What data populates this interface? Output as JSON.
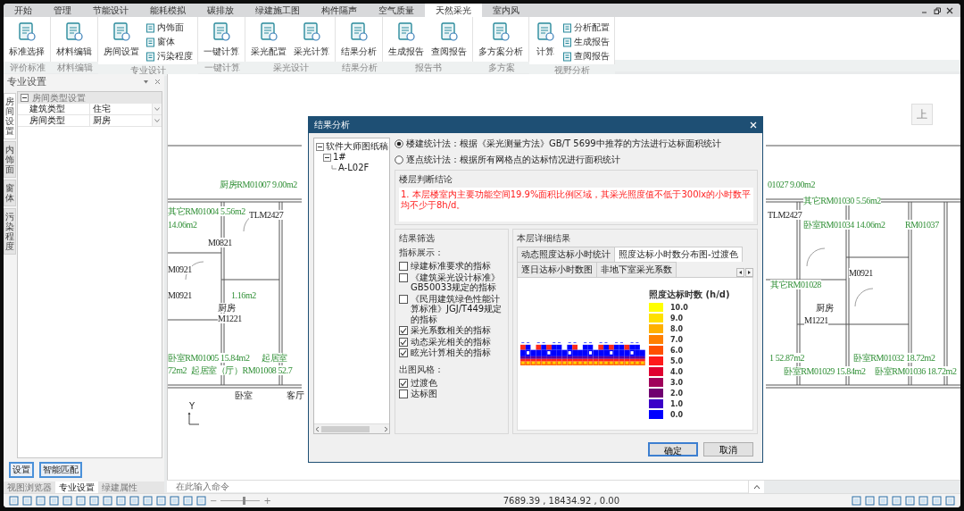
{
  "menu_tabs": [
    {
      "label": "开始",
      "selected": false
    },
    {
      "label": "管理",
      "selected": false
    },
    {
      "label": "节能设计",
      "selected": false
    },
    {
      "label": "能耗模拟",
      "selected": false
    },
    {
      "label": "碳排放",
      "selected": false
    },
    {
      "label": "绿建施工图",
      "selected": false
    },
    {
      "label": "构件隔声",
      "selected": false
    },
    {
      "label": "空气质量",
      "selected": false
    },
    {
      "label": "天然采光",
      "selected": true
    },
    {
      "label": "室内风",
      "selected": false
    }
  ],
  "ribbon": {
    "groups": [
      {
        "label": "评价标准",
        "buttons": [
          {
            "label": "标准选择",
            "kind": "large"
          }
        ]
      },
      {
        "label": "材料编辑",
        "buttons": [
          {
            "label": "材料编辑",
            "kind": "large"
          }
        ]
      },
      {
        "label": "专业设计",
        "buttons": [
          {
            "label": "房间设置",
            "kind": "large"
          },
          {
            "label": "内饰面",
            "kind": "small"
          },
          {
            "label": "窗体",
            "kind": "small"
          },
          {
            "label": "污染程度",
            "kind": "small"
          }
        ]
      },
      {
        "label": "一键计算",
        "buttons": [
          {
            "label": "一键计算",
            "kind": "large"
          }
        ]
      },
      {
        "label": "采光设计",
        "buttons": [
          {
            "label": "采光配置",
            "kind": "large"
          },
          {
            "label": "采光计算",
            "kind": "large"
          }
        ]
      },
      {
        "label": "结果分析",
        "buttons": [
          {
            "label": "结果分析",
            "kind": "large"
          }
        ]
      },
      {
        "label": "报告书",
        "buttons": [
          {
            "label": "生成报告",
            "kind": "large"
          },
          {
            "label": "查阅报告",
            "kind": "large"
          }
        ]
      },
      {
        "label": "多方案",
        "buttons": [
          {
            "label": "多方案分析",
            "kind": "large"
          }
        ]
      },
      {
        "label": "视野分析",
        "buttons": [
          {
            "label": "计算",
            "kind": "large"
          },
          {
            "label": "分析配置",
            "kind": "small"
          },
          {
            "label": "生成报告",
            "kind": "small"
          },
          {
            "label": "查阅报告",
            "kind": "small"
          }
        ]
      }
    ]
  },
  "side_panel": {
    "title": "专业设置",
    "side_tabs": [
      {
        "label": "房间设置",
        "selected": true
      },
      {
        "label": "内饰面",
        "selected": false
      },
      {
        "label": "窗体",
        "selected": false
      },
      {
        "label": "污染程度",
        "selected": false
      }
    ],
    "property_group": {
      "label": "房间类型设置",
      "expanded": true,
      "rows": [
        {
          "name": "建筑类型",
          "value": "住宅"
        },
        {
          "name": "房间类型",
          "value": "厨房"
        }
      ]
    },
    "buttons": [
      "设置",
      "智能匹配"
    ],
    "bottom_tabs": [
      {
        "label": "视图浏览器",
        "selected": false
      },
      {
        "label": "专业设置",
        "selected": true
      },
      {
        "label": "绿建属性",
        "selected": false
      }
    ]
  },
  "canvas": {
    "room_labels": [
      {
        "text": "厨房RM01007 9.00m2",
        "kind": "room"
      },
      {
        "text": "其它RM01004 5.56m2",
        "kind": "room"
      },
      {
        "text": "14.06m2",
        "kind": "room"
      },
      {
        "text": "TLM2427",
        "kind": "tag"
      },
      {
        "text": "M0821",
        "kind": "tag"
      },
      {
        "text": "M0921",
        "kind": "tag"
      },
      {
        "text": "M0921",
        "kind": "tag"
      },
      {
        "text": "1.16m2",
        "kind": "room"
      },
      {
        "text": "厨房",
        "kind": "tag"
      },
      {
        "text": "M1221",
        "kind": "tag"
      },
      {
        "text": "卧室RM01005 15.84m2",
        "kind": "room"
      },
      {
        "text": "起居室",
        "kind": "room"
      },
      {
        "text": "72m2",
        "kind": "room"
      },
      {
        "text": "起居室（厅）RM01008 52.7",
        "kind": "room"
      },
      {
        "text": "卧室",
        "kind": "tag"
      },
      {
        "text": "客厅",
        "kind": "tag"
      },
      {
        "text": "01027 9.00m2",
        "kind": "room"
      },
      {
        "text": "TLM2427",
        "kind": "tag"
      },
      {
        "text": "其它RM01030 5.56m2",
        "kind": "room"
      },
      {
        "text": "卧室RM01034 14.06m2",
        "kind": "room"
      },
      {
        "text": "RM01037",
        "kind": "room"
      },
      {
        "text": "M0921",
        "kind": "tag"
      },
      {
        "text": "其它RM01028",
        "kind": "room"
      },
      {
        "text": "厨房",
        "kind": "tag"
      },
      {
        "text": "M1221",
        "kind": "tag"
      },
      {
        "text": "1 52.87m2",
        "kind": "room"
      },
      {
        "text": "卧室RM01032 18.72m2",
        "kind": "room"
      },
      {
        "text": "卧室RM01029 15.84m2",
        "kind": "room"
      },
      {
        "text": "卧室RM01036 18.72m2",
        "kind": "room"
      }
    ],
    "ucs_label": "Y",
    "view_button": "上"
  },
  "dialog": {
    "title": "结果分析",
    "tree": [
      {
        "label": "软件大师图纸稿",
        "expanded": true,
        "children": [
          {
            "label": "1#",
            "expanded": true,
            "children": [
              {
                "label": "A-L02F"
              }
            ]
          }
        ]
      }
    ],
    "methods": [
      {
        "label": "楼建统计法：根据《采光测量方法》GB/T 5699中推荐的方法进行达标面积统计",
        "selected": true
      },
      {
        "label": "逐点统计法：根据所有网格点的达标情况进行面积统计",
        "selected": false
      }
    ],
    "conclusion": {
      "title": "楼层判断结论",
      "text": "1. 本层楼室内主要功能空间19.9%面积比例区域，其采光照度值不低于300lx的小时数平均不少于8h/d。"
    },
    "filter": {
      "title": "结果筛选",
      "indicator_label": "指标展示：",
      "indicators": [
        {
          "label": "绿建标准要求的指标",
          "checked": false
        },
        {
          "label": "《建筑采光设计标准》GB50033规定的指标",
          "checked": false
        },
        {
          "label": "《民用建筑绿色性能计算标准》JGJ/T449规定的指标",
          "checked": false
        },
        {
          "label": "采光系数相关的指标",
          "checked": true
        },
        {
          "label": "动态采光相关的指标",
          "checked": true
        },
        {
          "label": "眩光计算相关的指标",
          "checked": true
        }
      ],
      "style_label": "出图风格：",
      "styles": [
        {
          "label": "过渡色",
          "checked": true
        },
        {
          "label": "达标图",
          "checked": false
        }
      ]
    },
    "details": {
      "title": "本层详细结果",
      "tabs": [
        {
          "label": "动态照度达标小时统计",
          "selected": false
        },
        {
          "label": "照度达标小时数分布图-过渡色",
          "selected": true
        },
        {
          "label": "逐日达标小时数图",
          "selected": false
        },
        {
          "label": "非地下室采光系数",
          "selected": false
        }
      ],
      "legend": {
        "title": "照度达标时数 (h/d)",
        "items": [
          {
            "label": "10.0",
            "color": "#ffff00"
          },
          {
            "label": "9.0",
            "color": "#ffe000"
          },
          {
            "label": "8.0",
            "color": "#ffb000"
          },
          {
            "label": "7.0",
            "color": "#ff8000"
          },
          {
            "label": "6.0",
            "color": "#ff5000"
          },
          {
            "label": "5.0",
            "color": "#ff1a1a"
          },
          {
            "label": "4.0",
            "color": "#e00030"
          },
          {
            "label": "3.0",
            "color": "#a0005a"
          },
          {
            "label": "2.0",
            "color": "#700070"
          },
          {
            "label": "1.0",
            "color": "#3a00c8"
          },
          {
            "label": "0.0",
            "color": "#0000ff"
          }
        ]
      }
    },
    "buttons": [
      {
        "label": "确定",
        "default": true
      },
      {
        "label": "取消",
        "default": false
      }
    ]
  },
  "command_line": {
    "placeholder": "在此输入命令"
  },
  "status_bar": {
    "coordinates": "7689.39 , 18434.92 , 0.00",
    "zoom_out": "−",
    "zoom_in": "+",
    "zoom": {
      "level": 0.55
    }
  }
}
